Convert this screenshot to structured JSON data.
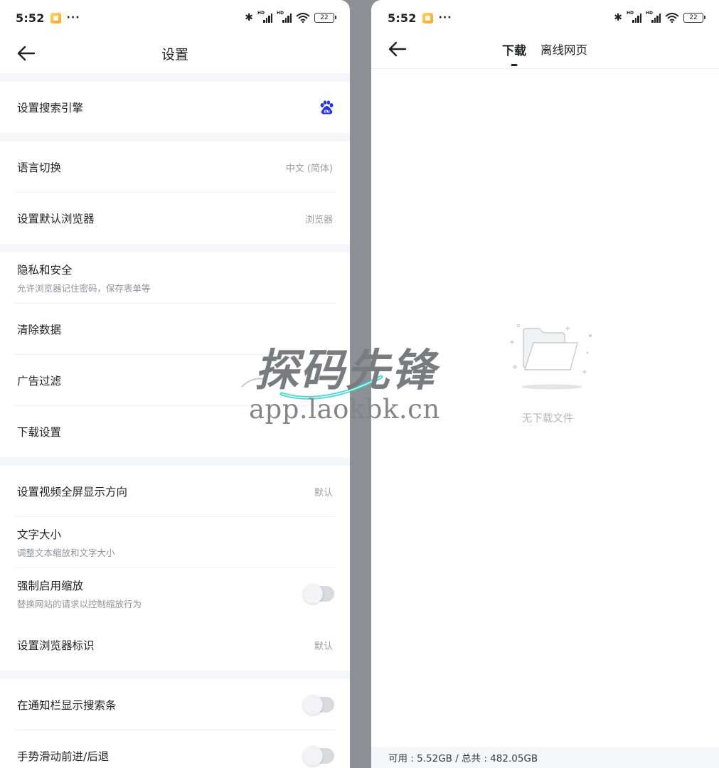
{
  "left_screen": {
    "status": {
      "time": "5:52",
      "battery": "22"
    },
    "header": {
      "title": "设置"
    },
    "groups": [
      {
        "items": [
          {
            "label": "设置搜索引擎",
            "kind": "icon",
            "icon": "baidu-icon"
          }
        ]
      },
      {
        "items": [
          {
            "label": "语言切换",
            "kind": "value",
            "value": "中文 (简体)"
          },
          {
            "label": "设置默认浏览器",
            "kind": "value",
            "value": "浏览器"
          }
        ]
      },
      {
        "items": [
          {
            "label": "隐私和安全",
            "sub": "允许浏览器记住密码，保存表单等",
            "kind": "none"
          },
          {
            "label": "清除数据",
            "kind": "none"
          },
          {
            "label": "广告过滤",
            "kind": "none"
          },
          {
            "label": "下载设置",
            "kind": "none"
          }
        ]
      },
      {
        "items": [
          {
            "label": "设置视频全屏显示方向",
            "kind": "value",
            "value": "默认"
          },
          {
            "label": "文字大小",
            "sub": "调整文本缩放和文字大小",
            "kind": "none"
          },
          {
            "label": "强制启用缩放",
            "sub": "替换网站的请求以控制缩放行为",
            "kind": "toggle",
            "on": false
          },
          {
            "label": "设置浏览器标识",
            "kind": "value",
            "value": "默认"
          }
        ]
      },
      {
        "items": [
          {
            "label": "在通知栏显示搜索条",
            "kind": "toggle",
            "on": false
          },
          {
            "label": "手势滑动前进/后退",
            "kind": "toggle",
            "on": false
          }
        ]
      }
    ]
  },
  "right_screen": {
    "status": {
      "time": "5:52",
      "battery": "22"
    },
    "tabs": [
      {
        "label": "下载",
        "active": true
      },
      {
        "label": "离线网页",
        "active": false
      }
    ],
    "empty_text": "无下载文件",
    "storage": "可用 : 5.52GB / 总共 : 482.05GB"
  },
  "watermark": {
    "title": "探码先锋",
    "url": "app.laokbk.cn"
  },
  "colors": {
    "background": "#ffffff",
    "gap": "#f5f6fa",
    "baidu_blue": "#2932e1",
    "toggle_off": "#d9dadf"
  }
}
